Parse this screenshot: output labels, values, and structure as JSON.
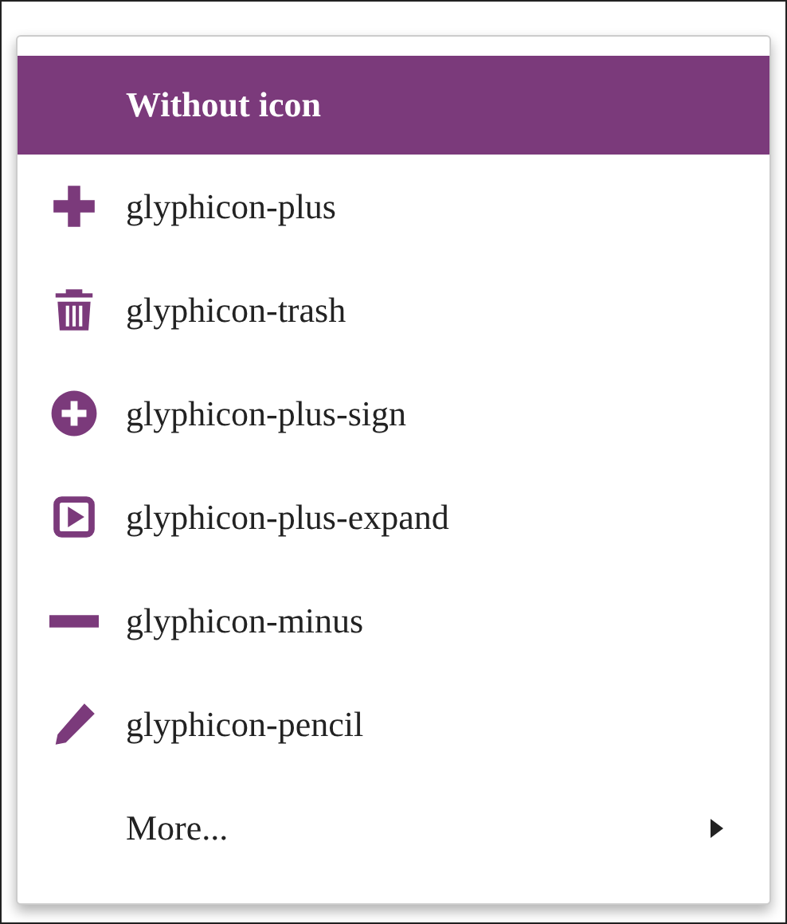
{
  "menu": {
    "items": [
      {
        "label": "Without icon",
        "kind": "plain",
        "selected": true
      },
      {
        "label": "glyphicon-plus",
        "kind": "icon",
        "selected": false
      },
      {
        "label": "glyphicon-trash",
        "kind": "icon",
        "selected": false
      },
      {
        "label": "glyphicon-plus-sign",
        "kind": "icon",
        "selected": false
      },
      {
        "label": "glyphicon-plus-expand",
        "kind": "icon",
        "selected": false
      },
      {
        "label": "glyphicon-minus",
        "kind": "icon",
        "selected": false
      },
      {
        "label": "glyphicon-pencil",
        "kind": "icon",
        "selected": false
      },
      {
        "label": "More...",
        "kind": "submenu",
        "selected": false
      }
    ]
  }
}
